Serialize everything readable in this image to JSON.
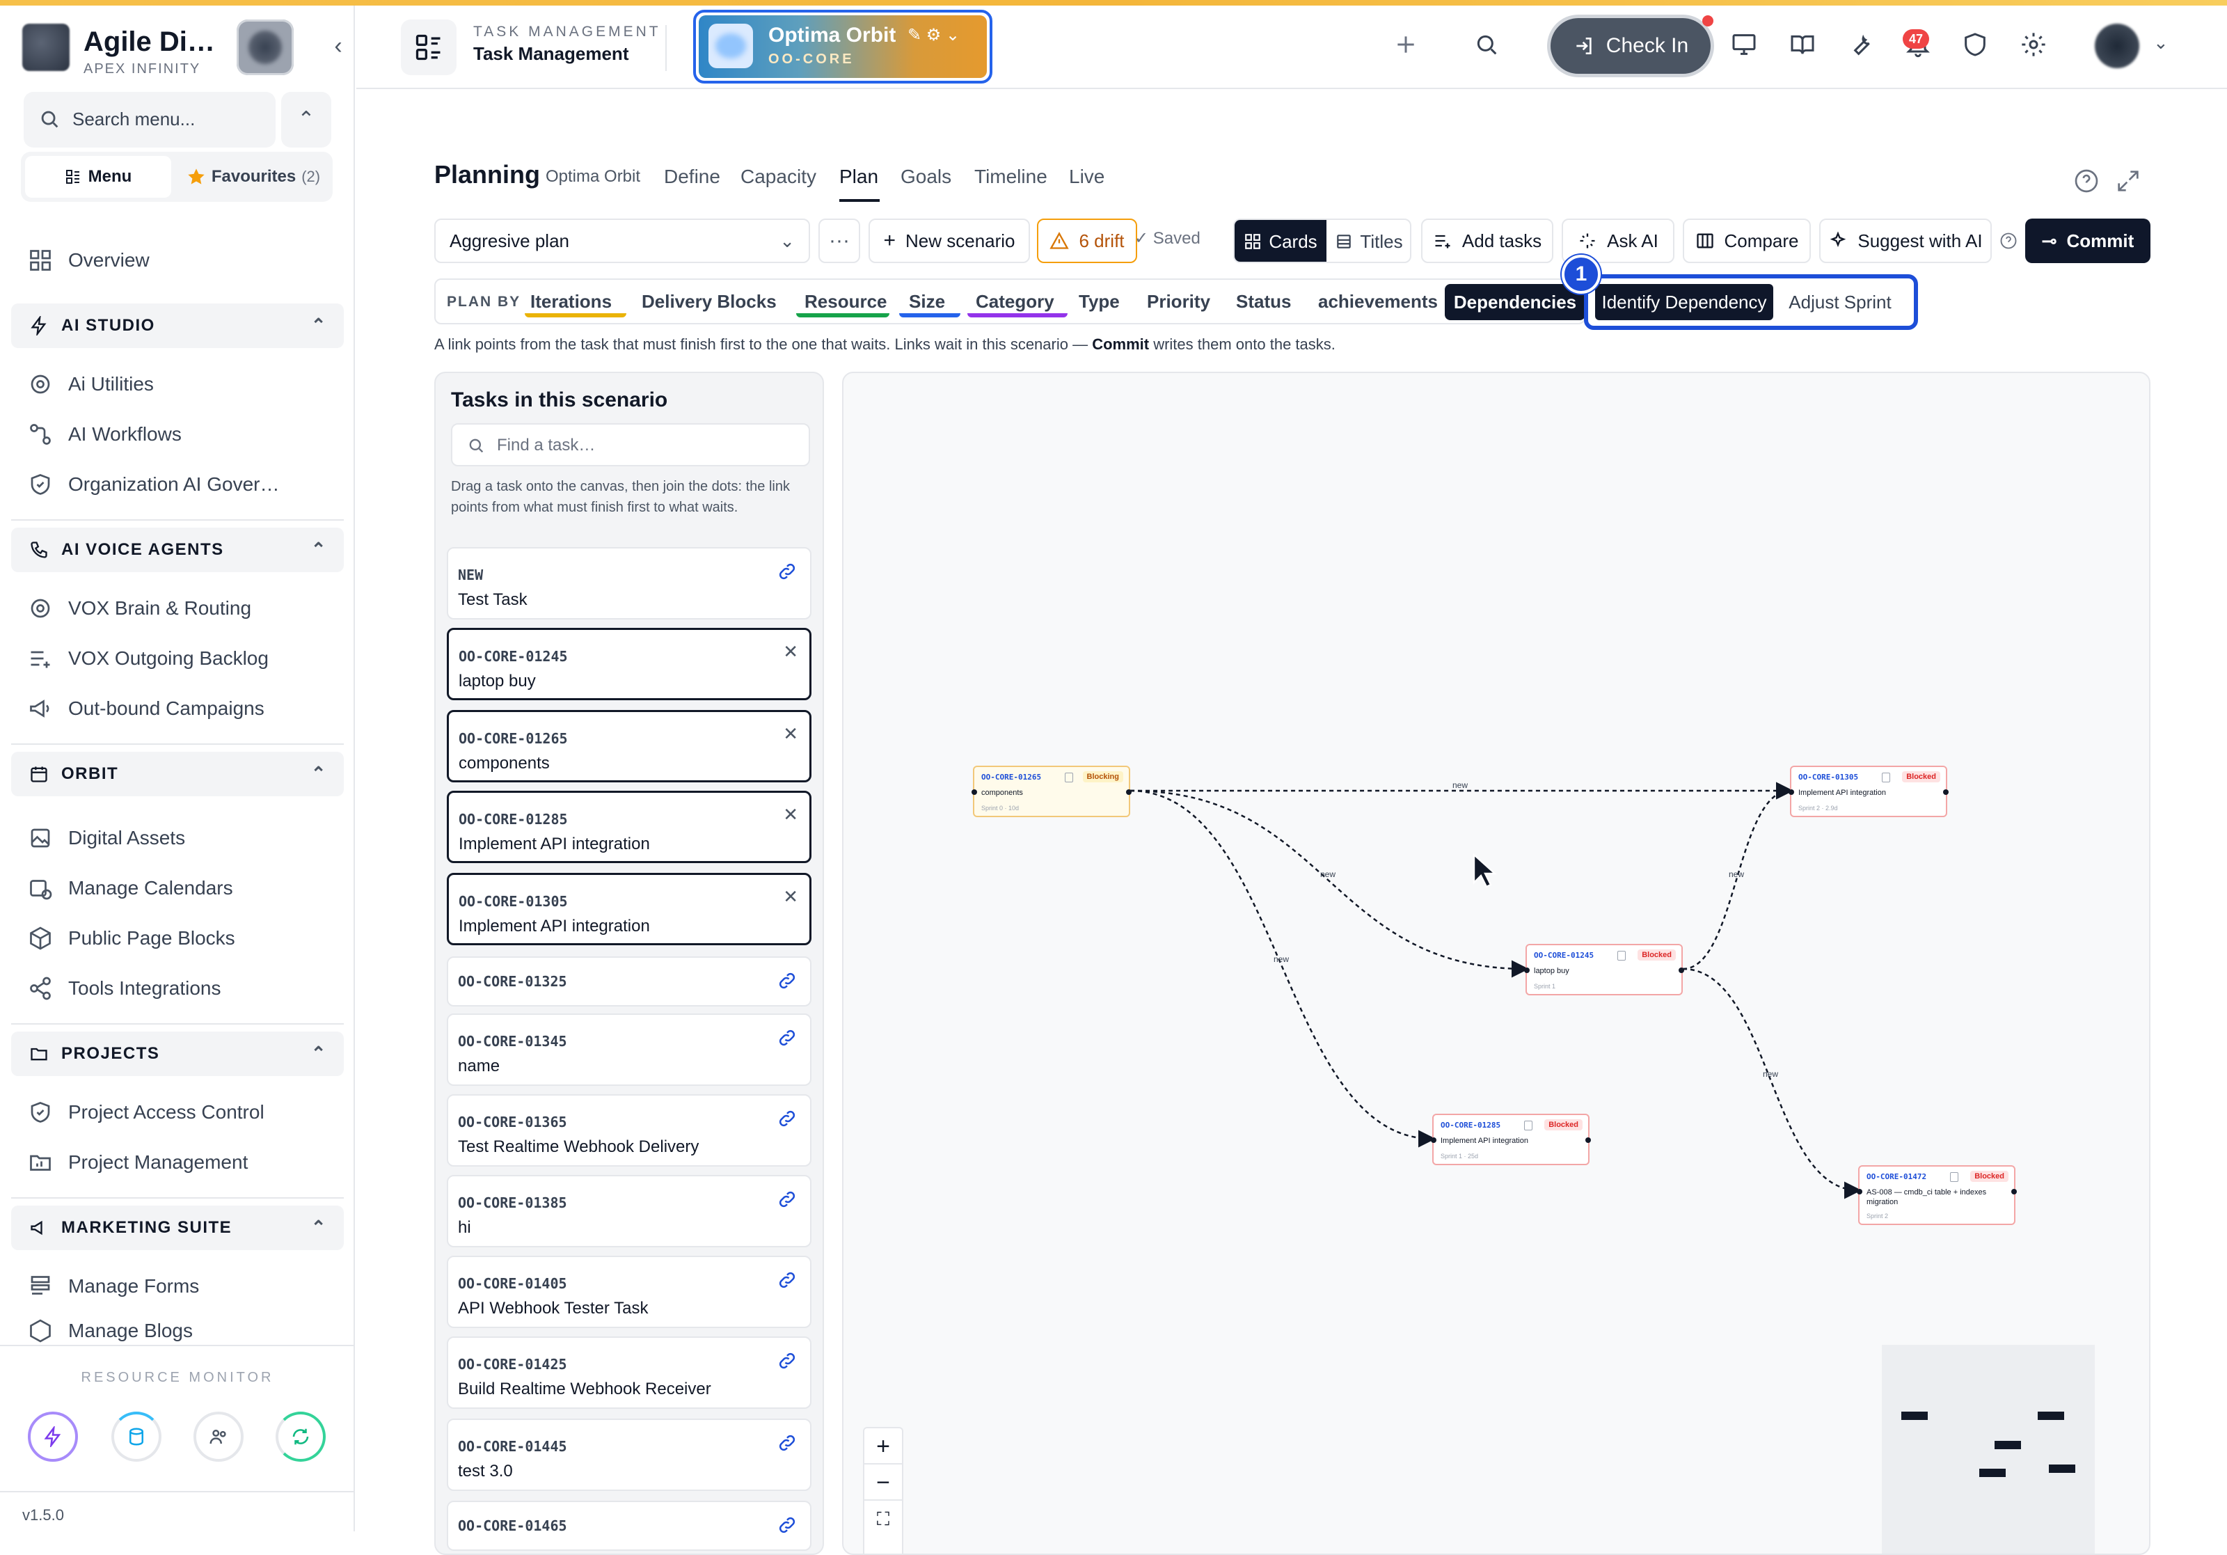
{
  "sidebar": {
    "brand_name": "Agile Di…",
    "brand_sub": "APEX INFINITY",
    "search_placeholder": "Search menu...",
    "tab_menu": "Menu",
    "tab_favourites": "Favourites",
    "favourites_count": "(2)",
    "overview": "Overview",
    "sections": [
      {
        "title": "AI STUDIO",
        "items": [
          "Ai Utilities",
          "AI Workflows",
          "Organization AI Gover…"
        ]
      },
      {
        "title": "AI VOICE AGENTS",
        "items": [
          "VOX Brain & Routing",
          "VOX Outgoing Backlog",
          "Out-bound Campaigns"
        ]
      },
      {
        "title": "ORBIT",
        "items": [
          "Digital Assets",
          "Manage Calendars",
          "Public Page Blocks",
          "Tools Integrations"
        ]
      },
      {
        "title": "PROJECTS",
        "items": [
          "Project Access Control",
          "Project Management"
        ]
      },
      {
        "title": "MARKETING SUITE",
        "items": [
          "Manage Forms",
          "Manage Blogs"
        ]
      }
    ],
    "resource_monitor": "RESOURCE MONITOR",
    "version": "v1.5.0"
  },
  "header": {
    "kicker": "TASK MANAGEMENT",
    "title": "Task Management",
    "project_name": "Optima Orbit",
    "project_code": "OO-CORE",
    "check_in": "Check In",
    "notifications": "47"
  },
  "planning": {
    "title": "Planning",
    "org": "Optima Orbit",
    "tabs": [
      "Define",
      "Capacity",
      "Plan",
      "Goals",
      "Timeline",
      "Live"
    ],
    "active_tab": "Plan",
    "scenario": "Aggresive plan",
    "new_scenario": "New scenario",
    "drift": "6 drift",
    "saved": "Saved",
    "cards": "Cards",
    "titles": "Titles",
    "add_tasks": "Add tasks",
    "ask_ai": "Ask AI",
    "compare": "Compare",
    "suggest": "Suggest with AI",
    "commit": "Commit",
    "plan_by_label": "PLAN BY",
    "plan_by": [
      "Iterations",
      "Delivery Blocks",
      "Resource",
      "Size",
      "Category",
      "Type",
      "Priority",
      "Status",
      "achievements",
      "Dependencies"
    ],
    "identify_dependency": "Identify Dependency",
    "adjust_sprint": "Adjust Sprint",
    "step": "1",
    "help_pre": "A link points from the task that must finish first to the one that waits. Links wait in this scenario — ",
    "help_bold": "Commit",
    "help_post": " writes them onto the tasks."
  },
  "tasks": {
    "title": "Tasks in this scenario",
    "search_placeholder": "Find a task…",
    "help": "Drag a task onto the canvas, then join the dots: the link points from what must finish first to what waits.",
    "items": [
      {
        "code": "NEW",
        "name": "Test Task",
        "selected": false
      },
      {
        "code": "OO-CORE-01245",
        "name": "laptop buy",
        "selected": true
      },
      {
        "code": "OO-CORE-01265",
        "name": "components",
        "selected": true
      },
      {
        "code": "OO-CORE-01285",
        "name": "Implement API integration",
        "selected": true
      },
      {
        "code": "OO-CORE-01305",
        "name": "Implement API integration",
        "selected": true
      },
      {
        "code": "OO-CORE-01325",
        "name": "",
        "selected": false
      },
      {
        "code": "OO-CORE-01345",
        "name": "name",
        "selected": false
      },
      {
        "code": "OO-CORE-01365",
        "name": "Test Realtime Webhook Delivery",
        "selected": false
      },
      {
        "code": "OO-CORE-01385",
        "name": "hi",
        "selected": false
      },
      {
        "code": "OO-CORE-01405",
        "name": "API Webhook Tester Task",
        "selected": false
      },
      {
        "code": "OO-CORE-01425",
        "name": "Build Realtime Webhook Receiver",
        "selected": false
      },
      {
        "code": "OO-CORE-01445",
        "name": "test 3.0",
        "selected": false
      },
      {
        "code": "OO-CORE-01465",
        "name": "",
        "selected": false
      }
    ]
  },
  "graph": {
    "nodes": [
      {
        "code": "OO-CORE-01265",
        "name": "components",
        "meta": "Sprint 0 · 10d",
        "badge": "Blocking"
      },
      {
        "code": "OO-CORE-01305",
        "name": "Implement API integration",
        "meta": "Sprint 2 · 2.9d",
        "badge": "Blocked"
      },
      {
        "code": "OO-CORE-01245",
        "name": "laptop buy",
        "meta": "Sprint 1",
        "badge": "Blocked"
      },
      {
        "code": "OO-CORE-01285",
        "name": "Implement API integration",
        "meta": "Sprint 1 · 25d",
        "badge": "Blocked"
      },
      {
        "code": "OO-CORE-01472",
        "name": "AS-008 — cmdb_ci table + indexes migration",
        "meta": "Sprint 2",
        "badge": "Blocked"
      }
    ],
    "edge_label": "new"
  }
}
